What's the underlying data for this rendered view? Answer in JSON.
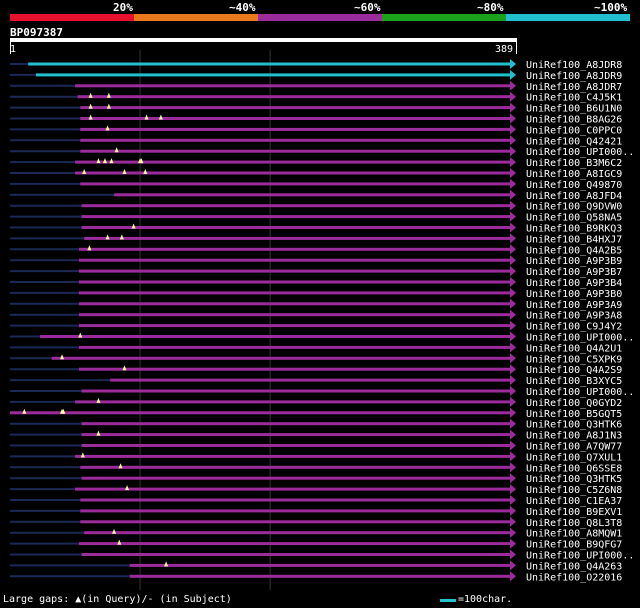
{
  "legend": {
    "labels": [
      "20%",
      "~40%",
      "~60%",
      "~80%",
      "~100%"
    ],
    "colors": [
      "#e8112d",
      "#e87a1d",
      "#9c2c9c",
      "#1ba11b",
      "#22bfcf"
    ]
  },
  "query": {
    "name": "BP097387",
    "start": "1",
    "end": "389",
    "length": 389
  },
  "footer": {
    "text": "Large gaps: ▲(in Query)/- (in Subject)",
    "scale_label": "=100char."
  },
  "hits": [
    {
      "name": "UniRef100_A8JDR8",
      "start": 14,
      "color": "#22bfcf",
      "gaps": []
    },
    {
      "name": "UniRef100_A8JDR9",
      "start": 20,
      "color": "#22bfcf",
      "gaps": []
    },
    {
      "name": "UniRef100_A8JDR7",
      "start": 50,
      "color": "#9c2c9c",
      "gaps": []
    },
    {
      "name": "UniRef100_C4J5K1",
      "start": 52,
      "color": "#9c2c9c",
      "gaps": [
        62,
        76
      ]
    },
    {
      "name": "UniRef100_B6U1N0",
      "start": 54,
      "color": "#9c2c9c",
      "gaps": [
        62,
        76
      ]
    },
    {
      "name": "UniRef100_B8AG26",
      "start": 54,
      "color": "#9c2c9c",
      "gaps": [
        62,
        105,
        116
      ]
    },
    {
      "name": "UniRef100_C0PPC0",
      "start": 54,
      "color": "#9c2c9c",
      "gaps": [
        75
      ]
    },
    {
      "name": "UniRef100_Q42421",
      "start": 54,
      "color": "#9c2c9c",
      "gaps": []
    },
    {
      "name": "UniRef100_UPI000..",
      "start": 54,
      "color": "#9c2c9c",
      "gaps": [
        82
      ]
    },
    {
      "name": "UniRef100_B3M6C2",
      "start": 50,
      "color": "#9c2c9c",
      "gaps": [
        68,
        73,
        78,
        100,
        101
      ]
    },
    {
      "name": "UniRef100_A8IGC9",
      "start": 50,
      "color": "#9c2c9c",
      "gaps": [
        57,
        88,
        104
      ]
    },
    {
      "name": "UniRef100_Q49870",
      "start": 54,
      "color": "#9c2c9c",
      "gaps": []
    },
    {
      "name": "UniRef100_A8JFD4",
      "start": 80,
      "color": "#9c2c9c",
      "gaps": []
    },
    {
      "name": "UniRef100_Q9DVW0",
      "start": 55,
      "color": "#9c2c9c",
      "gaps": []
    },
    {
      "name": "UniRef100_Q58NA5",
      "start": 55,
      "color": "#9c2c9c",
      "gaps": []
    },
    {
      "name": "UniRef100_B9RKQ3",
      "start": 55,
      "color": "#9c2c9c",
      "gaps": [
        95
      ]
    },
    {
      "name": "UniRef100_B4HXJ7",
      "start": 57,
      "color": "#9c2c9c",
      "gaps": [
        75,
        86
      ]
    },
    {
      "name": "UniRef100_Q4A2B5",
      "start": 53,
      "color": "#9c2c9c",
      "gaps": [
        61
      ]
    },
    {
      "name": "UniRef100_A9P3B9",
      "start": 53,
      "color": "#9c2c9c",
      "gaps": []
    },
    {
      "name": "UniRef100_A9P3B7",
      "start": 53,
      "color": "#9c2c9c",
      "gaps": []
    },
    {
      "name": "UniRef100_A9P3B4",
      "start": 53,
      "color": "#9c2c9c",
      "gaps": []
    },
    {
      "name": "UniRef100_A9P3B0",
      "start": 53,
      "color": "#9c2c9c",
      "gaps": []
    },
    {
      "name": "UniRef100_A9P3A9",
      "start": 53,
      "color": "#9c2c9c",
      "gaps": []
    },
    {
      "name": "UniRef100_A9P3A8",
      "start": 53,
      "color": "#9c2c9c",
      "gaps": []
    },
    {
      "name": "UniRef100_C9J4Y2",
      "start": 53,
      "color": "#9c2c9c",
      "gaps": []
    },
    {
      "name": "UniRef100_UPI000..",
      "start": 23,
      "color": "#9c2c9c",
      "gaps": [
        54
      ]
    },
    {
      "name": "UniRef100_Q4A2U1",
      "start": 53,
      "color": "#9c2c9c",
      "gaps": []
    },
    {
      "name": "UniRef100_C5XPK9",
      "start": 32,
      "color": "#9c2c9c",
      "gaps": [
        40
      ]
    },
    {
      "name": "UniRef100_Q4A2S9",
      "start": 53,
      "color": "#9c2c9c",
      "gaps": [
        88
      ]
    },
    {
      "name": "UniRef100_B3XYC5",
      "start": 77,
      "color": "#9c2c9c",
      "gaps": []
    },
    {
      "name": "UniRef100_UPI000..",
      "start": 55,
      "color": "#9c2c9c",
      "gaps": []
    },
    {
      "name": "UniRef100_Q0GYD2",
      "start": 50,
      "color": "#9c2c9c",
      "gaps": [
        68
      ]
    },
    {
      "name": "UniRef100_B5GQT5",
      "start": 0,
      "color": "#9c2c9c",
      "gaps": [
        11,
        40,
        41
      ]
    },
    {
      "name": "UniRef100_Q3HTK6",
      "start": 55,
      "color": "#9c2c9c",
      "gaps": []
    },
    {
      "name": "UniRef100_A8J1N3",
      "start": 55,
      "color": "#9c2c9c",
      "gaps": [
        68
      ]
    },
    {
      "name": "UniRef100_A7QW77",
      "start": 55,
      "color": "#9c2c9c",
      "gaps": []
    },
    {
      "name": "UniRef100_Q7XUL1",
      "start": 50,
      "color": "#9c2c9c",
      "gaps": [
        56
      ]
    },
    {
      "name": "UniRef100_Q6SSE8",
      "start": 54,
      "color": "#9c2c9c",
      "gaps": [
        85
      ]
    },
    {
      "name": "UniRef100_Q3HTK5",
      "start": 55,
      "color": "#9c2c9c",
      "gaps": []
    },
    {
      "name": "UniRef100_C5Z6N8",
      "start": 50,
      "color": "#9c2c9c",
      "gaps": [
        90
      ]
    },
    {
      "name": "UniRef100_C1EA37",
      "start": 54,
      "color": "#9c2c9c",
      "gaps": []
    },
    {
      "name": "UniRef100_B9EXV1",
      "start": 54,
      "color": "#9c2c9c",
      "gaps": []
    },
    {
      "name": "UniRef100_Q8L3T8",
      "start": 54,
      "color": "#9c2c9c",
      "gaps": []
    },
    {
      "name": "UniRef100_A8MQW1",
      "start": 57,
      "color": "#9c2c9c",
      "gaps": [
        80
      ]
    },
    {
      "name": "UniRef100_B9QFG7",
      "start": 53,
      "color": "#9c2c9c",
      "gaps": [
        84
      ]
    },
    {
      "name": "UniRef100_UPI000..",
      "start": 55,
      "color": "#9c2c9c",
      "gaps": []
    },
    {
      "name": "UniRef100_Q4A263",
      "start": 92,
      "color": "#9c2c9c",
      "gaps": [
        120
      ]
    },
    {
      "name": "UniRef100_O22016",
      "start": 92,
      "color": "#9c2c9c",
      "gaps": []
    }
  ]
}
